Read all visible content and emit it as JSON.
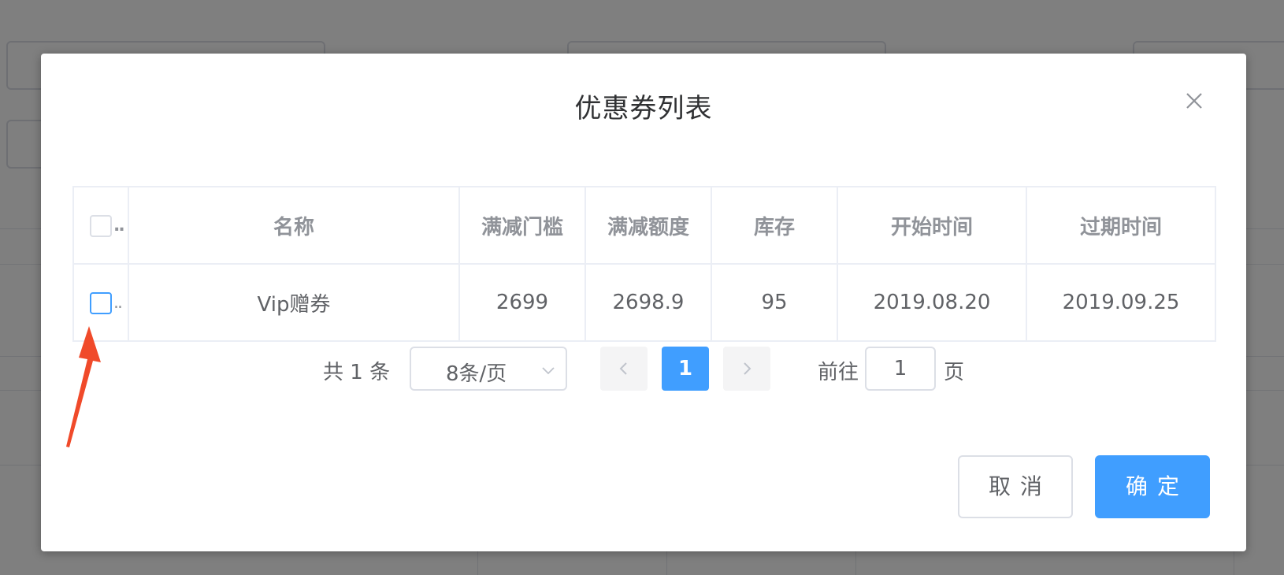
{
  "dialog": {
    "title": "优惠券列表",
    "close_icon": "close-icon"
  },
  "table": {
    "columns": [
      "名称",
      "满减门槛",
      "满减额度",
      "库存",
      "开始时间",
      "过期时间"
    ],
    "select_header_ellipsis": "..",
    "rows": [
      {
        "ellipsis": "..",
        "name": "Vip赠券",
        "threshold": "2699",
        "discount": "2698.9",
        "stock": "95",
        "start": "2019.08.20",
        "expire": "2019.09.25"
      }
    ]
  },
  "pagination": {
    "total": "共 1 条",
    "page_size": "8条/页",
    "current_page": "1",
    "goto_label": "前往",
    "goto_value": "1",
    "page_unit": "页",
    "prev_icon": "chevron-left-icon",
    "next_icon": "chevron-right-icon"
  },
  "footer": {
    "cancel": "取消",
    "confirm": "确定"
  },
  "colors": {
    "primary": "#409eff",
    "annotation_arrow": "#f04a2a"
  }
}
